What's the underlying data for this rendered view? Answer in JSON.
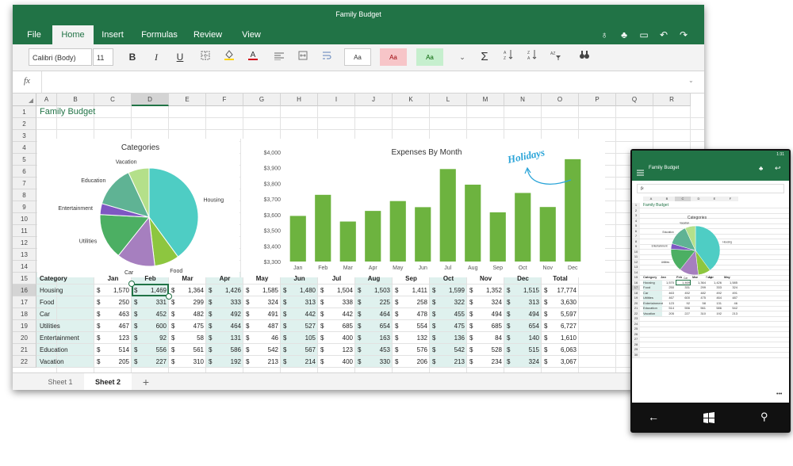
{
  "title": "Family Budget",
  "tabs": [
    {
      "label": "File"
    },
    {
      "label": "Home",
      "active": true
    },
    {
      "label": "Insert"
    },
    {
      "label": "Formulas"
    },
    {
      "label": "Review"
    },
    {
      "label": "View"
    }
  ],
  "title_icons": [
    "lightbulb-icon",
    "share-icon",
    "book-icon",
    "undo-icon",
    "redo-icon"
  ],
  "ribbon": {
    "font_name": "Calibri (Body)",
    "font_size": "11",
    "bold": "B",
    "italic": "I",
    "underline": "U",
    "styles": [
      "Aa",
      "Aa",
      "Aa"
    ]
  },
  "formula": {
    "fx": "fx",
    "value": ""
  },
  "columns": [
    "A",
    "B",
    "C",
    "D",
    "E",
    "F",
    "G",
    "H",
    "I",
    "J",
    "K",
    "L",
    "M",
    "N",
    "O",
    "P",
    "Q",
    "R"
  ],
  "selected_column": "D",
  "rows": [
    "1",
    "2",
    "3",
    "4",
    "5",
    "6",
    "7",
    "8",
    "9",
    "10",
    "11",
    "12",
    "13",
    "14",
    "15",
    "16",
    "17",
    "18",
    "19",
    "20",
    "21",
    "22"
  ],
  "selected_row": "16",
  "sheet_title": "Family Budget",
  "table": {
    "headers": [
      "Category",
      "Jan",
      "Feb",
      "Mar",
      "Apr",
      "May",
      "Jun",
      "Jul",
      "Aug",
      "Sep",
      "Oct",
      "Nov",
      "Dec",
      "Total"
    ],
    "rows": [
      {
        "category": "Housing",
        "values": [
          "1,570",
          "1,469",
          "1,364",
          "1,426",
          "1,585",
          "1,480",
          "1,504",
          "1,503",
          "1,411",
          "1,599",
          "1,352",
          "1,515",
          "17,774"
        ]
      },
      {
        "category": "Food",
        "values": [
          "250",
          "331",
          "299",
          "333",
          "324",
          "313",
          "338",
          "225",
          "258",
          "322",
          "324",
          "313",
          "3,630"
        ]
      },
      {
        "category": "Car",
        "values": [
          "463",
          "452",
          "482",
          "492",
          "491",
          "442",
          "442",
          "464",
          "478",
          "455",
          "494",
          "494",
          "5,597"
        ]
      },
      {
        "category": "Utilities",
        "values": [
          "467",
          "600",
          "475",
          "464",
          "487",
          "527",
          "685",
          "654",
          "554",
          "475",
          "685",
          "654",
          "6,727"
        ]
      },
      {
        "category": "Entertainment",
        "values": [
          "123",
          "92",
          "58",
          "131",
          "46",
          "105",
          "400",
          "163",
          "132",
          "136",
          "84",
          "140",
          "1,610"
        ]
      },
      {
        "category": "Education",
        "values": [
          "514",
          "556",
          "561",
          "586",
          "542",
          "567",
          "123",
          "453",
          "576",
          "542",
          "528",
          "515",
          "6,063"
        ]
      },
      {
        "category": "Vacation",
        "values": [
          "205",
          "227",
          "310",
          "192",
          "213",
          "214",
          "400",
          "330",
          "206",
          "213",
          "234",
          "324",
          "3,067"
        ]
      }
    ]
  },
  "chart_data": [
    {
      "type": "pie",
      "title": "Categories",
      "labels": [
        "Housing",
        "Food",
        "Car",
        "Utilities",
        "Entertainment",
        "Education",
        "Vacation"
      ],
      "values": [
        17774,
        3630,
        5597,
        6727,
        1610,
        6063,
        3067
      ],
      "colors": [
        "#4ecdc4",
        "#8dc63f",
        "#a67fbf",
        "#4caf63",
        "#7e57c2",
        "#5fb394",
        "#b4e08a"
      ]
    },
    {
      "type": "bar",
      "title": "Expenses By Month",
      "categories": [
        "Jan",
        "Feb",
        "Mar",
        "Apr",
        "May",
        "Jun",
        "Jul",
        "Aug",
        "Sep",
        "Oct",
        "Nov",
        "Dec"
      ],
      "values": [
        3592,
        3727,
        3556,
        3624,
        3687,
        3648,
        3892,
        3792,
        3615,
        3739,
        3649,
        3955
      ],
      "ylim": [
        3300,
        4000
      ],
      "yticks": [
        "$3,300",
        "$3,400",
        "$3,500",
        "$3,600",
        "$3,700",
        "$3,800",
        "$3,900",
        "$4,000"
      ],
      "color": "#6db33f"
    }
  ],
  "annotation": "Holidays",
  "sheets": [
    "Sheet 1",
    "Sheet 2"
  ],
  "add_sheet": "+",
  "phone": {
    "time": "1:31",
    "title": "Family Budget",
    "fx": "fx",
    "cols": [
      "A",
      "B",
      "C",
      "D",
      "E",
      "F"
    ],
    "headers": [
      "Category",
      "Jan",
      "Feb",
      "Mar",
      "Apr",
      "May"
    ],
    "rows": [
      "1",
      "2",
      "3",
      "4",
      "5",
      "6",
      "7",
      "8",
      "9",
      "10",
      "11",
      "12",
      "13",
      "14",
      "15",
      "16",
      "17",
      "18",
      "19",
      "20",
      "21",
      "22",
      "23",
      "24",
      "25",
      "26",
      "27",
      "28",
      "29",
      "30"
    ],
    "selected_row": "17"
  }
}
